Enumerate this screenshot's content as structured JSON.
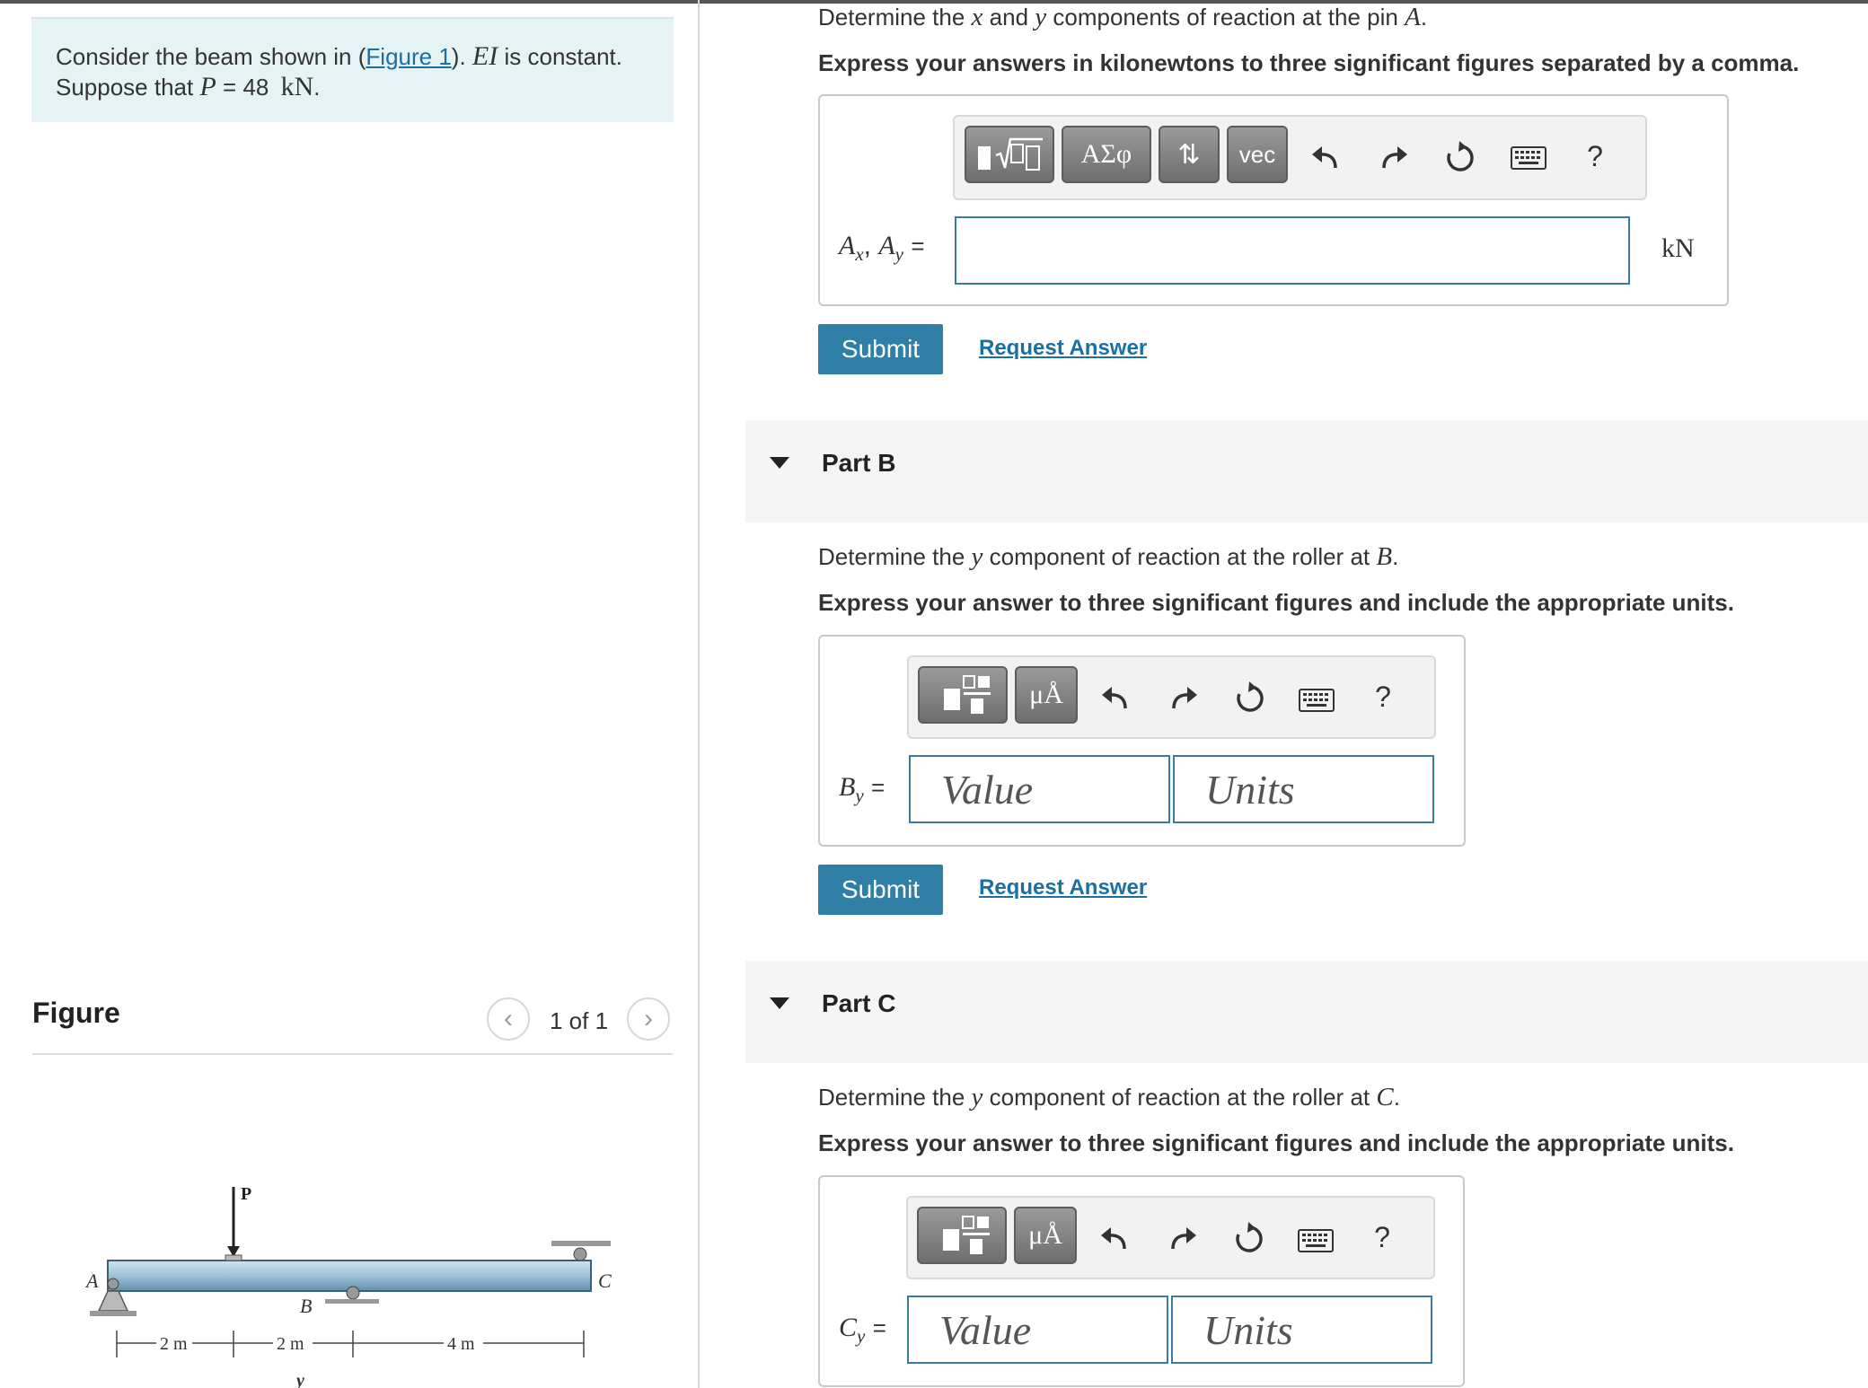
{
  "problem": {
    "text_before_link": "Consider the beam shown in (",
    "link_text": "Figure 1",
    "text_after_link": ").",
    "ei_symbol": "EI",
    "ei_suffix": "is constant.",
    "suppose_prefix": "Suppose that",
    "p_symbol": "P",
    "p_equals": "= 48",
    "p_unit": "kN",
    "p_end": "."
  },
  "figure": {
    "title": "Figure",
    "pager_prev": "‹",
    "pager_next": "›",
    "pager_count": "1 of 1",
    "labels": {
      "A": "A",
      "B": "B",
      "C": "C",
      "P": "P",
      "y": "y",
      "d1": "2 m",
      "d2": "2 m",
      "d3": "4 m"
    }
  },
  "partA": {
    "q_prefix": "Determine the",
    "q_x": "x",
    "q_and": "and",
    "q_y": "y",
    "q_mid": "components of reaction at the pin",
    "q_point": "A",
    "q_end": ".",
    "instruction": "Express your answers in kilonewtons to three significant figures separated by a comma.",
    "toolbar": {
      "greek": "ΑΣφ",
      "arrows": "⇅",
      "vec": "vec",
      "help": "?"
    },
    "label_ax": "A",
    "sub_x": "x",
    "comma": ",",
    "label_ay": "A",
    "sub_y": "y",
    "equals": "=",
    "unit": "kN",
    "answer_value": "",
    "submit": "Submit",
    "request": "Request Answer"
  },
  "partB": {
    "title": "Part B",
    "q_prefix": "Determine the",
    "q_y": "y",
    "q_mid": "component of reaction at the roller at",
    "q_point": "B",
    "q_end": ".",
    "instruction": "Express your answer to three significant figures and include the appropriate units.",
    "toolbar": {
      "units": "μÅ",
      "help": "?"
    },
    "label": "B",
    "sub": "y",
    "equals": "=",
    "value_placeholder": "Value",
    "units_placeholder": "Units",
    "submit": "Submit",
    "request": "Request Answer"
  },
  "partC": {
    "title": "Part C",
    "q_prefix": "Determine the",
    "q_y": "y",
    "q_mid": "component of reaction at the roller at",
    "q_point": "C",
    "q_end": ".",
    "instruction": "Express your answer to three significant figures and include the appropriate units.",
    "toolbar": {
      "units": "μÅ",
      "help": "?"
    },
    "label": "C",
    "sub": "y",
    "equals": "=",
    "value_placeholder": "Value",
    "units_placeholder": "Units"
  }
}
